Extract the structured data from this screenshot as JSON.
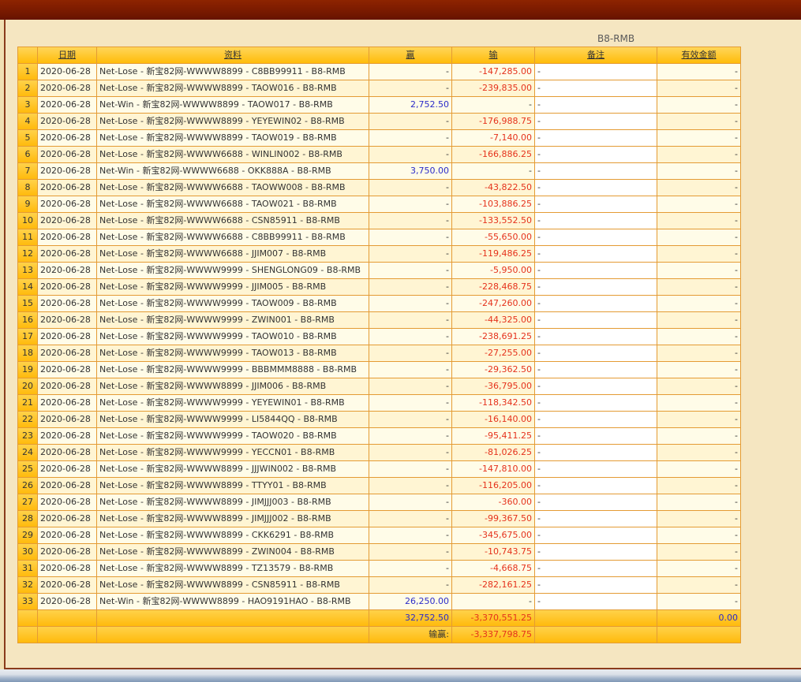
{
  "page": {
    "title": "B8-RMB"
  },
  "colors": {
    "win_text": "#2B2BC9",
    "lose_text": "#E5321C"
  },
  "table": {
    "headers": {
      "date": "日期",
      "info": "资料",
      "win": "赢",
      "lose": "输",
      "remark": "备注",
      "valid": "有效金额"
    },
    "rows": [
      {
        "no": "1",
        "date": "2020-06-28",
        "info": "Net-Lose - 新宝82网-WWWW8899 - C8BB99911 - B8-RMB",
        "win": "-",
        "lose": "-147,285.00",
        "remark": "-",
        "valid": "-"
      },
      {
        "no": "2",
        "date": "2020-06-28",
        "info": "Net-Lose - 新宝82网-WWWW8899 - TAOW016 - B8-RMB",
        "win": "-",
        "lose": "-239,835.00",
        "remark": "-",
        "valid": "-"
      },
      {
        "no": "3",
        "date": "2020-06-28",
        "info": "Net-Win - 新宝82网-WWWW8899 - TAOW017 - B8-RMB",
        "win": "2,752.50",
        "lose": "-",
        "remark": "-",
        "valid": "-"
      },
      {
        "no": "4",
        "date": "2020-06-28",
        "info": "Net-Lose - 新宝82网-WWWW8899 - YEYEWIN02 - B8-RMB",
        "win": "-",
        "lose": "-176,988.75",
        "remark": "-",
        "valid": "-"
      },
      {
        "no": "5",
        "date": "2020-06-28",
        "info": "Net-Lose - 新宝82网-WWWW8899 - TAOW019 - B8-RMB",
        "win": "-",
        "lose": "-7,140.00",
        "remark": "-",
        "valid": "-"
      },
      {
        "no": "6",
        "date": "2020-06-28",
        "info": "Net-Lose - 新宝82网-WWWW6688 - WINLIN002 - B8-RMB",
        "win": "-",
        "lose": "-166,886.25",
        "remark": "-",
        "valid": "-"
      },
      {
        "no": "7",
        "date": "2020-06-28",
        "info": "Net-Win - 新宝82网-WWWW6688 - OKK888A - B8-RMB",
        "win": "3,750.00",
        "lose": "-",
        "remark": "-",
        "valid": "-"
      },
      {
        "no": "8",
        "date": "2020-06-28",
        "info": "Net-Lose - 新宝82网-WWWW6688 - TAOWW008 - B8-RMB",
        "win": "-",
        "lose": "-43,822.50",
        "remark": "-",
        "valid": "-"
      },
      {
        "no": "9",
        "date": "2020-06-28",
        "info": "Net-Lose - 新宝82网-WWWW6688 - TAOW021 - B8-RMB",
        "win": "-",
        "lose": "-103,886.25",
        "remark": "-",
        "valid": "-"
      },
      {
        "no": "10",
        "date": "2020-06-28",
        "info": "Net-Lose - 新宝82网-WWWW6688 - CSN85911 - B8-RMB",
        "win": "-",
        "lose": "-133,552.50",
        "remark": "-",
        "valid": "-"
      },
      {
        "no": "11",
        "date": "2020-06-28",
        "info": "Net-Lose - 新宝82网-WWWW6688 - C8BB99911 - B8-RMB",
        "win": "-",
        "lose": "-55,650.00",
        "remark": "-",
        "valid": "-"
      },
      {
        "no": "12",
        "date": "2020-06-28",
        "info": "Net-Lose - 新宝82网-WWWW6688 - JJIM007 - B8-RMB",
        "win": "-",
        "lose": "-119,486.25",
        "remark": "-",
        "valid": "-"
      },
      {
        "no": "13",
        "date": "2020-06-28",
        "info": "Net-Lose - 新宝82网-WWWW9999 - SHENGLONG09 - B8-RMB",
        "win": "-",
        "lose": "-5,950.00",
        "remark": "-",
        "valid": "-"
      },
      {
        "no": "14",
        "date": "2020-06-28",
        "info": "Net-Lose - 新宝82网-WWWW9999 - JJIM005 - B8-RMB",
        "win": "-",
        "lose": "-228,468.75",
        "remark": "-",
        "valid": "-"
      },
      {
        "no": "15",
        "date": "2020-06-28",
        "info": "Net-Lose - 新宝82网-WWWW9999 - TAOW009 - B8-RMB",
        "win": "-",
        "lose": "-247,260.00",
        "remark": "-",
        "valid": "-"
      },
      {
        "no": "16",
        "date": "2020-06-28",
        "info": "Net-Lose - 新宝82网-WWWW9999 - ZWIN001 - B8-RMB",
        "win": "-",
        "lose": "-44,325.00",
        "remark": "-",
        "valid": "-"
      },
      {
        "no": "17",
        "date": "2020-06-28",
        "info": "Net-Lose - 新宝82网-WWWW9999 - TAOW010 - B8-RMB",
        "win": "-",
        "lose": "-238,691.25",
        "remark": "-",
        "valid": "-"
      },
      {
        "no": "18",
        "date": "2020-06-28",
        "info": "Net-Lose - 新宝82网-WWWW9999 - TAOW013 - B8-RMB",
        "win": "-",
        "lose": "-27,255.00",
        "remark": "-",
        "valid": "-"
      },
      {
        "no": "19",
        "date": "2020-06-28",
        "info": "Net-Lose - 新宝82网-WWWW9999 - BBBMMM8888 - B8-RMB",
        "win": "-",
        "lose": "-29,362.50",
        "remark": "-",
        "valid": "-"
      },
      {
        "no": "20",
        "date": "2020-06-28",
        "info": "Net-Lose - 新宝82网-WWWW8899 - JJIM006 - B8-RMB",
        "win": "-",
        "lose": "-36,795.00",
        "remark": "-",
        "valid": "-"
      },
      {
        "no": "21",
        "date": "2020-06-28",
        "info": "Net-Lose - 新宝82网-WWWW9999 - YEYEWIN01 - B8-RMB",
        "win": "-",
        "lose": "-118,342.50",
        "remark": "-",
        "valid": "-"
      },
      {
        "no": "22",
        "date": "2020-06-28",
        "info": "Net-Lose - 新宝82网-WWWW9999 - LI5844QQ - B8-RMB",
        "win": "-",
        "lose": "-16,140.00",
        "remark": "-",
        "valid": "-"
      },
      {
        "no": "23",
        "date": "2020-06-28",
        "info": "Net-Lose - 新宝82网-WWWW9999 - TAOW020 - B8-RMB",
        "win": "-",
        "lose": "-95,411.25",
        "remark": "-",
        "valid": "-"
      },
      {
        "no": "24",
        "date": "2020-06-28",
        "info": "Net-Lose - 新宝82网-WWWW9999 - YECCN01 - B8-RMB",
        "win": "-",
        "lose": "-81,026.25",
        "remark": "-",
        "valid": "-"
      },
      {
        "no": "25",
        "date": "2020-06-28",
        "info": "Net-Lose - 新宝82网-WWWW8899 - JJJWIN002 - B8-RMB",
        "win": "-",
        "lose": "-147,810.00",
        "remark": "-",
        "valid": "-"
      },
      {
        "no": "26",
        "date": "2020-06-28",
        "info": "Net-Lose - 新宝82网-WWWW8899 - TTYY01 - B8-RMB",
        "win": "-",
        "lose": "-116,205.00",
        "remark": "-",
        "valid": "-"
      },
      {
        "no": "27",
        "date": "2020-06-28",
        "info": "Net-Lose - 新宝82网-WWWW8899 - JIMJJJ003 - B8-RMB",
        "win": "-",
        "lose": "-360.00",
        "remark": "-",
        "valid": "-"
      },
      {
        "no": "28",
        "date": "2020-06-28",
        "info": "Net-Lose - 新宝82网-WWWW8899 - JIMJJJ002 - B8-RMB",
        "win": "-",
        "lose": "-99,367.50",
        "remark": "-",
        "valid": "-"
      },
      {
        "no": "29",
        "date": "2020-06-28",
        "info": "Net-Lose - 新宝82网-WWWW8899 - CKK6291 - B8-RMB",
        "win": "-",
        "lose": "-345,675.00",
        "remark": "-",
        "valid": "-"
      },
      {
        "no": "30",
        "date": "2020-06-28",
        "info": "Net-Lose - 新宝82网-WWWW8899 - ZWIN004 - B8-RMB",
        "win": "-",
        "lose": "-10,743.75",
        "remark": "-",
        "valid": "-"
      },
      {
        "no": "31",
        "date": "2020-06-28",
        "info": "Net-Lose - 新宝82网-WWWW8899 - TZ13579 - B8-RMB",
        "win": "-",
        "lose": "-4,668.75",
        "remark": "-",
        "valid": "-"
      },
      {
        "no": "32",
        "date": "2020-06-28",
        "info": "Net-Lose - 新宝82网-WWWW8899 - CSN85911 - B8-RMB",
        "win": "-",
        "lose": "-282,161.25",
        "remark": "-",
        "valid": "-"
      },
      {
        "no": "33",
        "date": "2020-06-28",
        "info": "Net-Win - 新宝82网-WWWW8899 - HAO9191HAO - B8-RMB",
        "win": "26,250.00",
        "lose": "-",
        "remark": "-",
        "valid": "-"
      }
    ],
    "totals": {
      "win": "32,752.50",
      "lose": "-3,370,551.25",
      "valid": "0.00"
    },
    "net": {
      "label": "输赢:",
      "value": "-3,337,798.75"
    }
  }
}
